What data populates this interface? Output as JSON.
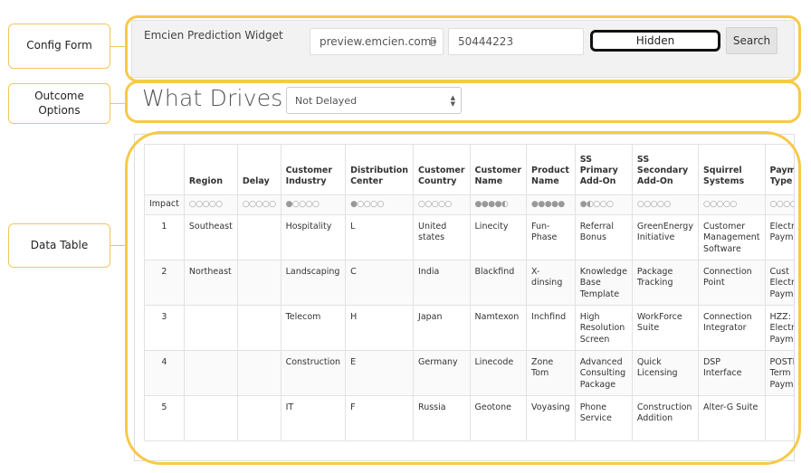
{
  "callouts": {
    "config": "Config Form",
    "outcome": "Outcome Options",
    "table": "Data Table"
  },
  "config": {
    "title": "Emcien Prediction Widget",
    "host_value": "preview.emcien.com",
    "id_value": "50444223",
    "hidden_label": "Hidden",
    "search_label": "Search"
  },
  "outcome": {
    "title": "What Drives:",
    "selected": "Not Delayed"
  },
  "table": {
    "impact_label": "Impact",
    "columns": [
      "",
      "Region",
      "Delay",
      "Customer Industry",
      "Distribution Center",
      "Customer Country",
      "Customer Name",
      "Product Name",
      "SS Primary Add-On",
      "SS Secondary Add-On",
      "Squirrel Systems",
      "Payment Type"
    ],
    "impact": [
      "○○○○○",
      "○○○○○",
      "●○○○○",
      "●○○○○",
      "○○○○○",
      "●●●●◐",
      "●●●●●",
      "●◐○○○",
      "○○○○○",
      "○○○○○",
      "○○○○○"
    ],
    "rows": [
      [
        "1",
        "Southeast",
        "",
        "Hospitality",
        "L",
        "United states",
        "Linecity",
        "Fun-Phase",
        "Referral Bonus",
        "GreenEnergy Initiative",
        "Customer Management Software",
        "Electronic Payment"
      ],
      [
        "2",
        "Northeast",
        "",
        "Landscaping",
        "C",
        "India",
        "Blackfind",
        "X-dinsing",
        "Knowledge Base Template",
        "Package Tracking",
        "Connection Point",
        "Cust Electronic Payment"
      ],
      [
        "3",
        "",
        "",
        "Telecom",
        "H",
        "Japan",
        "Namtexon",
        "Inchfind",
        "High Resolution Screen",
        "WorkForce Suite",
        "Connection Integrator",
        "HZZ: Electronic Payment"
      ],
      [
        "4",
        "",
        "",
        "Construction",
        "E",
        "Germany",
        "Linecode",
        "Zone Tom",
        "Advanced Consulting Package",
        "Quick Licensing",
        "DSP Interface",
        "POSTED Term Paymnt"
      ],
      [
        "5",
        "",
        "",
        "IT",
        "F",
        "Russia",
        "Geotone",
        "Voyasing",
        "Phone Service",
        "Construction Addition",
        "Alter-G Suite",
        ""
      ]
    ]
  },
  "colors": {
    "highlight": "#f7c948",
    "callout_border": "#f0c75e"
  }
}
